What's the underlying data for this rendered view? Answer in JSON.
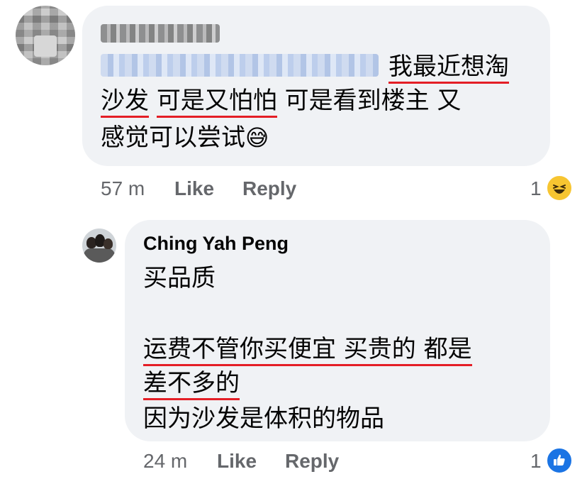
{
  "comment": {
    "author_name": "Blurred name",
    "mention": "Blurred mention",
    "lines": [
      "我最近想淘",
      "沙发",
      "可是又怕怕",
      "可是看到楼主 又",
      "感觉可以尝试"
    ],
    "emoji": "😅",
    "timestamp": "57 m",
    "like_label": "Like",
    "reply_label": "Reply",
    "reaction_count": "1",
    "reaction_icon": "haha-reaction-icon"
  },
  "reply": {
    "author_name": "Ching Yah Peng",
    "lines": [
      "买品质",
      "运费不管你买便宜 买贵的 都是",
      "差不多的",
      "因为沙发是体积的物品"
    ],
    "timestamp": "24 m",
    "like_label": "Like",
    "reply_label": "Reply",
    "reaction_count": "1",
    "reaction_icon": "like-reaction-icon"
  },
  "colors": {
    "bubble": "#f0f2f5",
    "underline": "#e41e26",
    "meta_text": "#65676b",
    "like_blue": "#1b74e4",
    "haha_yellow": "#f7c531"
  }
}
